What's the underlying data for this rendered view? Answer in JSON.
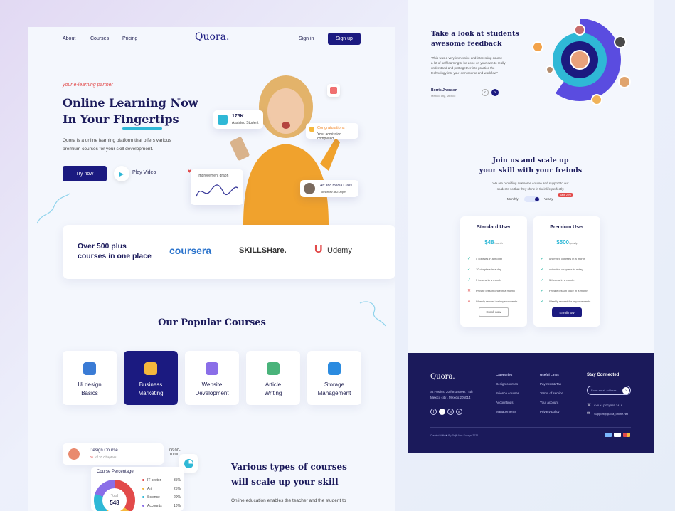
{
  "nav": {
    "about": "About",
    "courses": "Courses",
    "pricing": "Pricing",
    "logo": "Quora.",
    "signin": "Sign in",
    "signup": "Sign up"
  },
  "hero": {
    "tagline": "your e-learning partner",
    "title_line1": "Online Learning Now",
    "title_line2": "In Your Fingertips",
    "desc_line1": "Quora is a online learning platform that offers various",
    "desc_line2": "premium courses for your skill development.",
    "try_now": "Try now",
    "play_video": "Play Video"
  },
  "floats": {
    "students_count": "175K",
    "students_label": "Assisted Student",
    "congrats": "Congratulations !",
    "congrats_sub": "Your admission completed",
    "graph_label": "Improvement graph",
    "class_title": "Art and media Class",
    "class_time": "Tomorrow at 2:00pm"
  },
  "partners": {
    "headline_line1": "Over 500 plus",
    "headline_line2": "courses in one place",
    "coursera": "coursera",
    "skillshare": "SKILLSHare.",
    "udemy": "Udemy"
  },
  "popular": {
    "title": "Our Popular Courses",
    "courses": [
      {
        "line1": "Ui design",
        "line2": "Basics",
        "color": "#3a7bd5"
      },
      {
        "line1": "Business",
        "line2": "Marketing",
        "color": "#f5b83d"
      },
      {
        "line1": "Website",
        "line2": "Development",
        "color": "#8a6ee8"
      },
      {
        "line1": "Article",
        "line2": "Writing",
        "color": "#49b37a"
      },
      {
        "line1": "Storage",
        "line2": "Management",
        "color": "#2b8be0"
      }
    ]
  },
  "design_course": {
    "title": "Design Course",
    "time": "06:00-10:00",
    "progress": "05",
    "progress_suffix": "of 20 Chapters"
  },
  "course_pct": {
    "title": "Course Percentage",
    "total_label": "Total",
    "total_value": "548",
    "rows": [
      {
        "name": "IT sector",
        "pct": "35%",
        "color": "#e24a4a"
      },
      {
        "name": "Art",
        "pct": "25%",
        "color": "#f5b83d"
      },
      {
        "name": "Science",
        "pct": "20%",
        "color": "#2fb8d6"
      },
      {
        "name": "Accounts",
        "pct": "10%",
        "color": "#8a6ee8"
      }
    ]
  },
  "various": {
    "title_line1": "Various types of courses",
    "title_line2": "will scale up your skill",
    "desc": "Online education enables the teacher and the student to"
  },
  "feedback": {
    "title_line1": "Take a look at students",
    "title_line2": "awesome feedback",
    "quote": "\"This was a very immersive and interesting course — a lot of self-learning to be done on your own to really understand and put together into practice the technology into your own course and workflow\"",
    "name": "Borris Jhonson",
    "location": "Mexico city, Mexico"
  },
  "pricing": {
    "title_line1": "Join us and scale up",
    "title_line2": "your skill with your freinds",
    "desc_line1": "We are providing awesome course and support to our",
    "desc_line2": "students so that they shine in their life perfectly.",
    "monthly": "Monthly",
    "yearly": "Yearly",
    "save_badge": "Save 20%",
    "standard": {
      "name": "Standard User",
      "price": "$48",
      "period": "/month",
      "button": "Enroll now",
      "features": [
        {
          "text": "5 courses in a month",
          "ok": true
        },
        {
          "text": "10 chapters in a day",
          "ok": true
        },
        {
          "text": "5 forums in a month",
          "ok": true
        },
        {
          "text": "Private lesson once in a month",
          "ok": false
        },
        {
          "text": "Weekly reward for improvements",
          "ok": false
        }
      ]
    },
    "premium": {
      "name": "Premium User",
      "price": "$500",
      "period": "/yearly",
      "button": "Enroll now",
      "features": [
        {
          "text": "unlimited courses in a month",
          "ok": true
        },
        {
          "text": "unlimited chapters in a day",
          "ok": true
        },
        {
          "text": "5 forums in a month",
          "ok": true
        },
        {
          "text": "Private lesson once in a month",
          "ok": true
        },
        {
          "text": "Weekly reward for improvements",
          "ok": true
        }
      ]
    }
  },
  "footer": {
    "logo": "Quora.",
    "address_line1": "St Fosliss, 20 forst street , 4th",
    "address_line2": "Mexico city , Mexico 205014",
    "categories_title": "Categories",
    "categories": [
      "Design courses",
      "Science courses",
      "Accountings",
      "Managements"
    ],
    "links_title": "Useful Links",
    "links": [
      "Payment & Tax",
      "Terms of service",
      "Your account",
      "Privacy policy"
    ],
    "connected_title": "Stay Connected",
    "email_placeholder": "Enter email address",
    "phone": "Call +1(202) 555-3418",
    "email": "Support@quora_online.net",
    "copyright": "Created With ❤ By Rajib Das Supriyo 2024"
  },
  "colors": {
    "navy": "#1b1a80",
    "footer_bg": "#1b1a5b",
    "accent": "#2fb8d6"
  }
}
